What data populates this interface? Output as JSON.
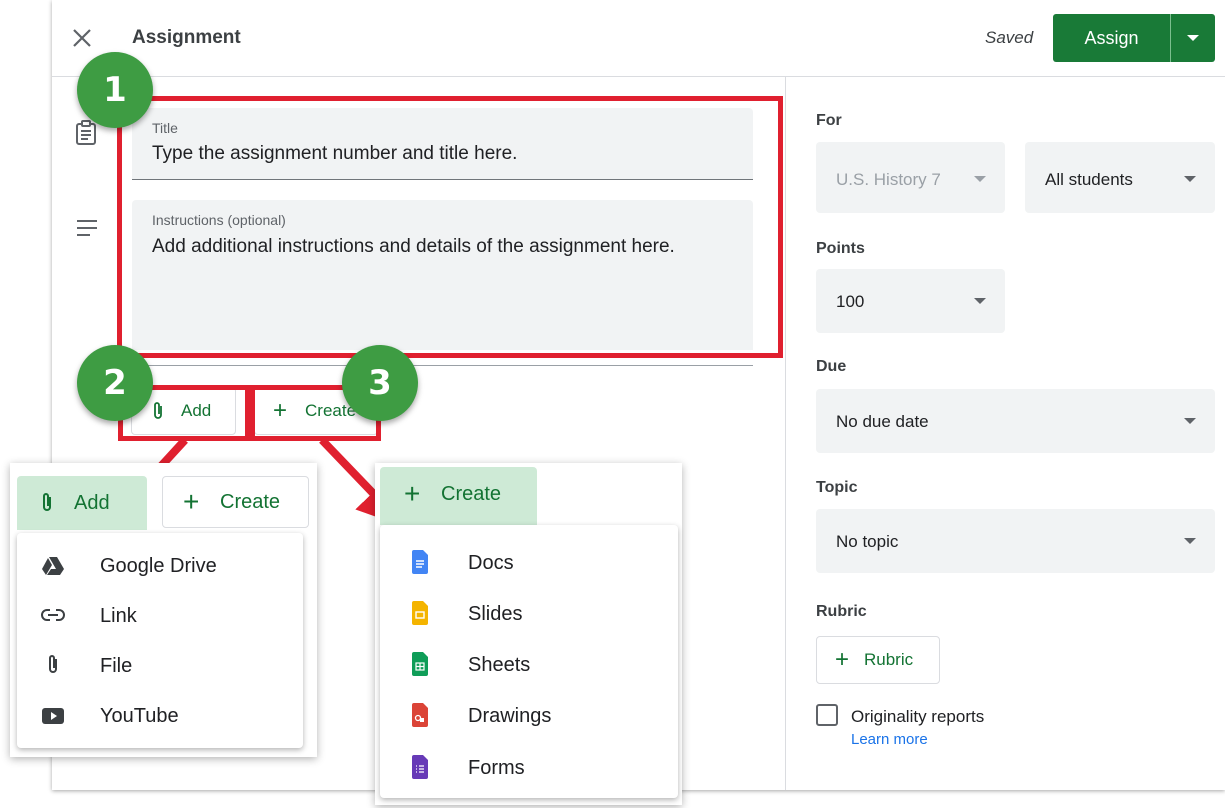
{
  "header": {
    "title": "Assignment",
    "status": "Saved",
    "assign_label": "Assign"
  },
  "form": {
    "title_label": "Title",
    "title_value": "Type the assignment number and title here.",
    "instructions_label": "Instructions (optional)",
    "instructions_value": "Add additional instructions and details of the assignment here.",
    "add_label": "Add",
    "create_label": "Create"
  },
  "badges": [
    "1",
    "2",
    "3"
  ],
  "add_popup": {
    "add_label": "Add",
    "create_label": "Create",
    "items": [
      {
        "label": "Google Drive",
        "icon": "google-drive-icon"
      },
      {
        "label": "Link",
        "icon": "link-icon"
      },
      {
        "label": "File",
        "icon": "attach-file-icon"
      },
      {
        "label": "YouTube",
        "icon": "youtube-icon"
      }
    ]
  },
  "create_popup": {
    "create_label": "Create",
    "items": [
      {
        "label": "Docs",
        "icon": "docs-icon",
        "color": "#4285f4"
      },
      {
        "label": "Slides",
        "icon": "slides-icon",
        "color": "#f4b400"
      },
      {
        "label": "Sheets",
        "icon": "sheets-icon",
        "color": "#0f9d58"
      },
      {
        "label": "Drawings",
        "icon": "drawings-icon",
        "color": "#db4437"
      },
      {
        "label": "Forms",
        "icon": "forms-icon",
        "color": "#673ab7"
      }
    ]
  },
  "sidebar": {
    "for_label": "For",
    "class_value": "U.S. History 7",
    "students_value": "All students",
    "points_label": "Points",
    "points_value": "100",
    "due_label": "Due",
    "due_value": "No due date",
    "topic_label": "Topic",
    "topic_value": "No topic",
    "rubric_label": "Rubric",
    "rubric_button": "Rubric",
    "originality_label": "Originality reports",
    "learn_more": "Learn more"
  },
  "colors": {
    "accent": "#197a37",
    "highlight": "#e0202f",
    "badge": "#3e9c43",
    "link": "#1a73e8"
  }
}
